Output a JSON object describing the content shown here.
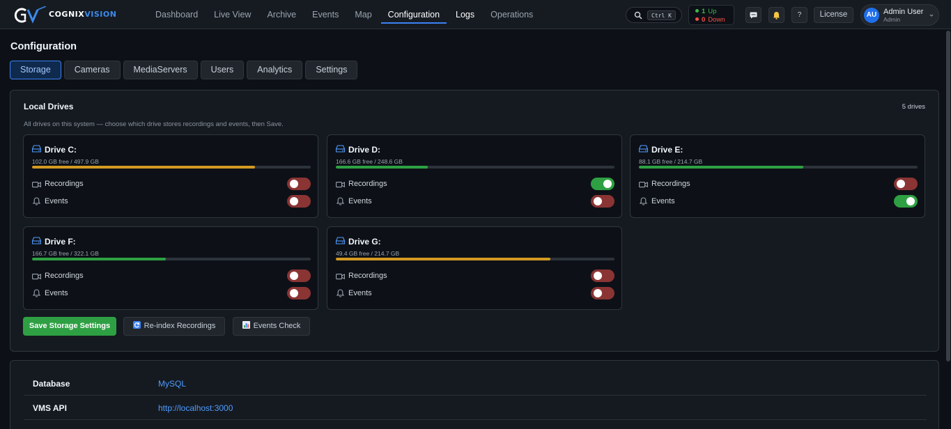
{
  "app": {
    "logo_main": "COGNIX",
    "logo_accent": "VISION"
  },
  "nav": {
    "links": [
      "Dashboard",
      "Live View",
      "Archive",
      "Events",
      "Map",
      "Configuration",
      "Logs",
      "Operations"
    ],
    "active": "Configuration"
  },
  "header": {
    "search_shortcut": "Ctrl K",
    "status": {
      "up_count": "1",
      "up_label": "Up",
      "down_count": "0",
      "down_label": "Down"
    },
    "help_label": "?",
    "license_label": "License",
    "user": {
      "initials": "AU",
      "name": "Admin User",
      "role": "Admin"
    }
  },
  "page": {
    "title": "Configuration",
    "tabs": [
      "Storage",
      "Cameras",
      "MediaServers",
      "Users",
      "Analytics",
      "Settings"
    ],
    "active_tab": "Storage"
  },
  "storage": {
    "title": "Local Drives",
    "count_label": "5 drives",
    "description": "All drives on this system — choose which drive stores recordings and events, then Save.",
    "drives": [
      {
        "name": "Drive C:",
        "capacity": "102.0 GB free / 497.9 GB",
        "used_fraction": 0.8,
        "bar_color": "#d29922",
        "recordings": false,
        "events": false
      },
      {
        "name": "Drive D:",
        "capacity": "166.6 GB free / 248.6 GB",
        "used_fraction": 0.33,
        "bar_color": "#2ea043",
        "recordings": true,
        "events": false
      },
      {
        "name": "Drive E:",
        "capacity": "88.1 GB free / 214.7 GB",
        "used_fraction": 0.59,
        "bar_color": "#2ea043",
        "recordings": false,
        "events": true
      },
      {
        "name": "Drive F:",
        "capacity": "166.7 GB free / 322.1 GB",
        "used_fraction": 0.48,
        "bar_color": "#2ea043",
        "recordings": false,
        "events": false
      },
      {
        "name": "Drive G:",
        "capacity": "49.4 GB free / 214.7 GB",
        "used_fraction": 0.77,
        "bar_color": "#d29922",
        "recordings": false,
        "events": false
      }
    ],
    "recordings_label": "Recordings",
    "events_label": "Events",
    "save_label": "Save Storage Settings",
    "reindex_label": "Re-index Recordings",
    "events_check_label": "Events Check"
  },
  "system_info": [
    {
      "key": "Database",
      "value": "MySQL"
    },
    {
      "key": "VMS API",
      "value": "http://localhost:3000"
    }
  ],
  "colors": {
    "accent": "#3b82f6",
    "success": "#2ea043",
    "warning": "#d29922",
    "danger": "#8b3434"
  }
}
